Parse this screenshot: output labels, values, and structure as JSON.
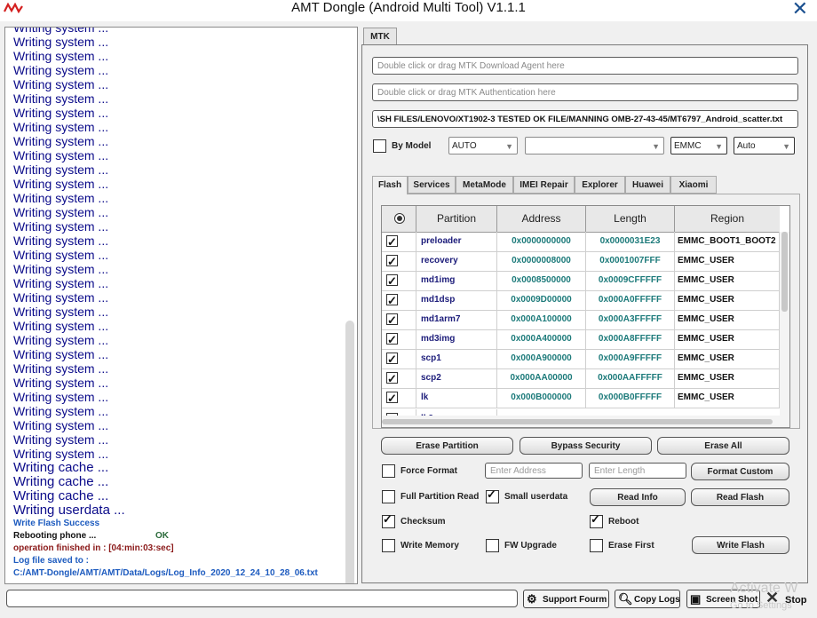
{
  "window": {
    "title": "AMT Dongle (Android Multi Tool) V1.1.1"
  },
  "log": {
    "lines": [
      "Writing system ...",
      "Writing system ...",
      "Writing system ...",
      "Writing system ...",
      "Writing system ...",
      "Writing system ...",
      "Writing system ...",
      "Writing system ...",
      "Writing system ...",
      "Writing system ...",
      "Writing system ...",
      "Writing system ...",
      "Writing system ...",
      "Writing system ...",
      "Writing system ...",
      "Writing system ...",
      "Writing system ...",
      "Writing system ...",
      "Writing system ...",
      "Writing system ...",
      "Writing system ...",
      "Writing system ...",
      "Writing system ...",
      "Writing system ...",
      "Writing system ...",
      "Writing system ...",
      "Writing system ...",
      "Writing system ...",
      "Writing system ...",
      "Writing system ...",
      "Writing system ...",
      "Writing cache ...",
      "Writing cache ...",
      "Writing cache ...",
      "Writing userdata ..."
    ],
    "write_flash_success": "Write Flash Success",
    "rebooting": "Rebooting phone ...",
    "rebooting_status": "OK",
    "operation_finished": "operation finished in : [04:min:03:sec]",
    "log_saved_label": "Log file saved to :",
    "log_path": "C:/AMT-Dongle/AMT/AMT/Data/Logs/Log_Info_2020_12_24_10_28_06.txt"
  },
  "main_tab": "MTK",
  "mtk": {
    "da_placeholder": "Double click or drag MTK Download Agent here",
    "auth_placeholder": "Double click or drag MTK Authentication here",
    "scatter_value": "\\SH FILES/LENOVO/XT1902-3 TESTED OK FILE/MANNING OMB-27-43-45/MT6797_Android_scatter.txt",
    "by_model_label": "By Model",
    "model_combo": "AUTO",
    "variant_combo": "",
    "storage_combo": "EMMC",
    "mode_combo": "Auto"
  },
  "subtabs": [
    "Flash",
    "Services",
    "MetaMode",
    "IMEI Repair",
    "Explorer",
    "Huawei",
    "Xiaomi"
  ],
  "table": {
    "headers": [
      "Partition",
      "Address",
      "Length",
      "Region"
    ],
    "rows": [
      {
        "partition": "preloader",
        "address": "0x0000000000",
        "length": "0x0000031E23",
        "region": "EMMC_BOOT1_BOOT2"
      },
      {
        "partition": "recovery",
        "address": "0x0000008000",
        "length": "0x0001007FFF",
        "region": "EMMC_USER"
      },
      {
        "partition": "md1img",
        "address": "0x0008500000",
        "length": "0x0009CFFFFF",
        "region": "EMMC_USER"
      },
      {
        "partition": "md1dsp",
        "address": "0x0009D00000",
        "length": "0x000A0FFFFF",
        "region": "EMMC_USER"
      },
      {
        "partition": "md1arm7",
        "address": "0x000A100000",
        "length": "0x000A3FFFFF",
        "region": "EMMC_USER"
      },
      {
        "partition": "md3img",
        "address": "0x000A400000",
        "length": "0x000A8FFFFF",
        "region": "EMMC_USER"
      },
      {
        "partition": "scp1",
        "address": "0x000A900000",
        "length": "0x000A9FFFFF",
        "region": "EMMC_USER"
      },
      {
        "partition": "scp2",
        "address": "0x000AA00000",
        "length": "0x000AAFFFFF",
        "region": "EMMC_USER"
      },
      {
        "partition": "lk",
        "address": "0x000B000000",
        "length": "0x000B0FFFFF",
        "region": "EMMC_USER"
      }
    ]
  },
  "buttons": {
    "erase_partition": "Erase Partition",
    "bypass_security": "Bypass Security",
    "erase_all": "Erase All",
    "format_custom": "Format Custom",
    "read_info": "Read Info",
    "read_flash": "Read Flash",
    "write_flash": "Write Flash"
  },
  "options": {
    "force_format": "Force Format",
    "full_partition_read": "Full Partition Read",
    "small_userdata": "Small userdata",
    "checksum": "Checksum",
    "reboot": "Reboot",
    "write_memory": "Write Memory",
    "fw_upgrade": "FW Upgrade",
    "erase_first": "Erase First",
    "enter_address_placeholder": "Enter Address",
    "enter_length_placeholder": "Enter Length"
  },
  "bottom": {
    "support_forum": "Support Fourm",
    "copy_logs": "Copy Logs",
    "screen_shot": "Screen Shot",
    "stop": "Stop",
    "watermark_line1": "Activate W",
    "watermark_line2": "Go to Settings"
  }
}
